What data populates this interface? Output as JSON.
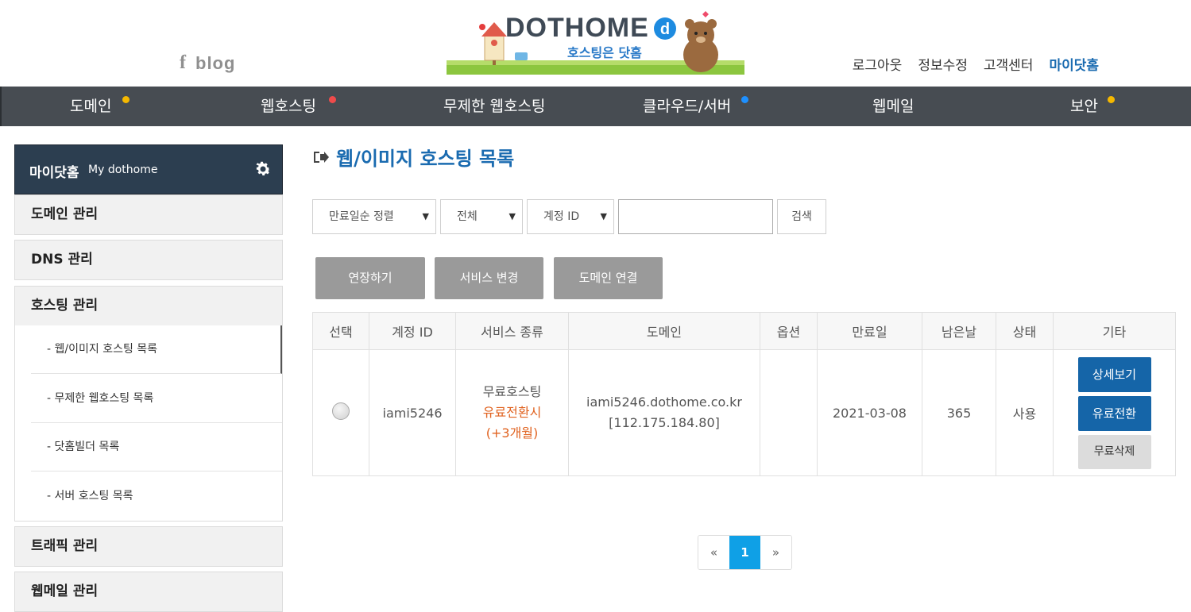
{
  "header": {
    "social": {
      "facebook": "f",
      "blog": "blog"
    },
    "logo": {
      "brand": "DOTHOME",
      "slogan": "호스팅은 닷홈"
    },
    "top_links": [
      "로그아웃",
      "정보수정",
      "고객센터",
      "마이닷홈"
    ]
  },
  "nav": {
    "items": [
      {
        "label": "도메인",
        "dot_color": "#f5b800"
      },
      {
        "label": "웹호스팅",
        "dot_color": "#ef4b4b"
      },
      {
        "label": "무제한 웹호스팅",
        "dot_color": ""
      },
      {
        "label": "클라우드/서버",
        "dot_color": "#1e90ff"
      },
      {
        "label": "웹메일",
        "dot_color": ""
      },
      {
        "label": "보안",
        "dot_color": "#f5b800"
      }
    ]
  },
  "sidebar": {
    "title": "마이닷홈",
    "subtitle": "My dothome",
    "menus": [
      "도메인 관리",
      "DNS 관리",
      "호스팅 관리",
      "트래픽 관리",
      "웹메일 관리"
    ],
    "sub_items": [
      "- 웹/이미지 호스팅 목록",
      "- 무제한 웹호스팅 목록",
      "- 닷홈빌더 목록",
      "- 서버 호스팅 목록"
    ]
  },
  "main": {
    "title": "웹/이미지 호스팅 목록",
    "filters": {
      "sort": "만료일순 정렬",
      "scope": "전체",
      "field": "계정 ID",
      "search_value": "",
      "search_button": "검색"
    },
    "action_buttons": [
      "연장하기",
      "서비스 변경",
      "도메인 연결"
    ],
    "table": {
      "headers": [
        "선택",
        "계정 ID",
        "서비스 종류",
        "도메인",
        "옵션",
        "만료일",
        "남은날",
        "상태",
        "기타"
      ],
      "row": {
        "account_id": "iami5246",
        "service_line1": "무료호스팅",
        "service_line2": "유료전환시",
        "service_line3": "(+3개월)",
        "domain": "iami5246.dothome.co.kr",
        "ip": "[112.175.184.80]",
        "option": "",
        "expiry": "2021-03-08",
        "days_left": "365",
        "status": "사용",
        "buttons": [
          "상세보기",
          "유료전환",
          "무료삭제"
        ]
      }
    },
    "pagination": {
      "prev": "«",
      "current": "1",
      "next": "»"
    }
  }
}
